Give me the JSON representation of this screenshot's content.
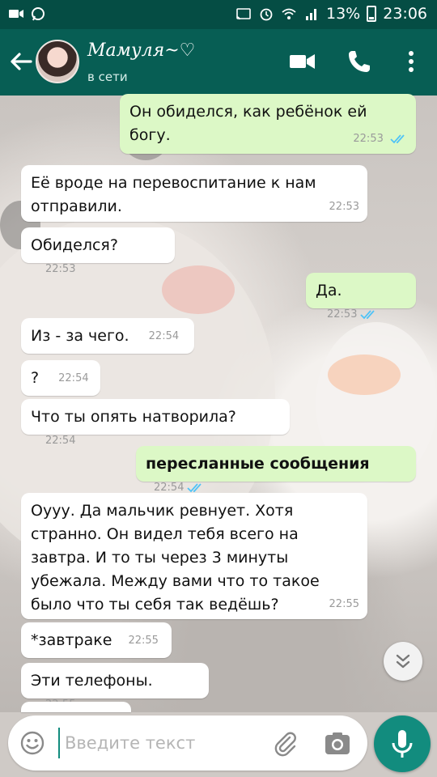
{
  "status_bar": {
    "battery": "13%",
    "time": "23:06"
  },
  "header": {
    "contact_name": "Мамуля~♡",
    "status": "в сети"
  },
  "messages": [
    {
      "dir": "out",
      "text": "Он обиделся, как ребёнок ей богу.",
      "time": "22:53",
      "read": true
    },
    {
      "dir": "in",
      "text": "Её вроде на перевоспитание к нам отправили.",
      "time": "22:53"
    },
    {
      "dir": "in",
      "text": "Обиделся?",
      "time": "22:53"
    },
    {
      "dir": "out",
      "text": "Да.",
      "time": "22:53",
      "read": true
    },
    {
      "dir": "in",
      "text": "Из - за чего.",
      "time": "22:54"
    },
    {
      "dir": "in",
      "text": "?",
      "time": "22:54"
    },
    {
      "dir": "in",
      "text": "Что ты опять натворила?",
      "time": "22:54"
    },
    {
      "dir": "out",
      "text": "пересланные сообщения",
      "time": "22:54",
      "read": true
    },
    {
      "dir": "in",
      "text": "Оууу. Да мальчик ревнует. Хотя странно. Он видел тебя всего на завтра. И то ты через 3 минуты убежала. Между вами что то такое было что ты себя так ведёшь?",
      "time": "22:55"
    },
    {
      "dir": "in",
      "text": "*завтраке",
      "time": "22:55"
    },
    {
      "dir": "in",
      "text": "Эти телефоны.",
      "time": "22:55"
    }
  ],
  "input": {
    "placeholder": "Введите текст"
  },
  "colors": {
    "header": "#075e54",
    "status_bar": "#054d44",
    "outgoing": "#dcf8c6",
    "incoming": "#ffffff",
    "accent": "#128c7e",
    "read_ticks": "#4fc3f7"
  },
  "icons": {
    "toolbar": [
      "back-arrow-icon",
      "video-call-icon",
      "phone-icon",
      "more-vert-icon"
    ],
    "input": [
      "emoji-icon",
      "attach-icon",
      "camera-icon",
      "mic-icon"
    ],
    "scroll": "chevron-double-down-icon"
  }
}
